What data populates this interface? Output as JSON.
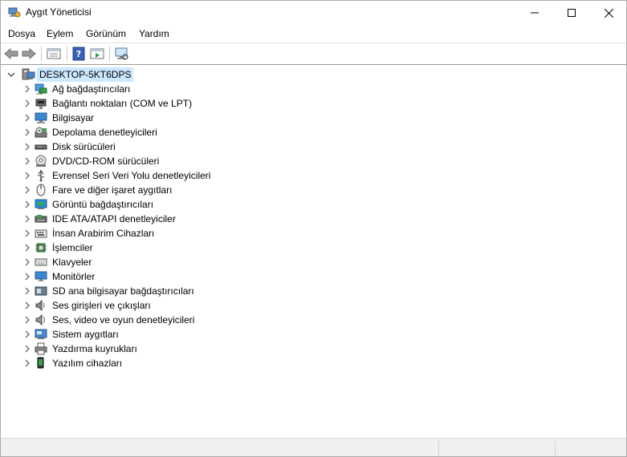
{
  "window": {
    "title": "Aygıt Yöneticisi"
  },
  "menu": {
    "items": [
      "Dosya",
      "Eylem",
      "Görünüm",
      "Yardım"
    ]
  },
  "toolbar": {
    "buttons": [
      "back-arrow-icon",
      "forward-arrow-icon",
      "properties-icon",
      "help-icon",
      "update-driver-icon",
      "scan-hardware-icon"
    ]
  },
  "tree": {
    "root": "DESKTOP-5KT6DPS",
    "items": [
      {
        "label": "Ağ bağdaştırıcıları",
        "icon": "network-adapter-icon"
      },
      {
        "label": "Bağlantı noktaları (COM ve LPT)",
        "icon": "port-icon"
      },
      {
        "label": "Bilgisayar",
        "icon": "computer-icon"
      },
      {
        "label": "Depolama denetleyicileri",
        "icon": "storage-controller-icon"
      },
      {
        "label": "Disk sürücüleri",
        "icon": "disk-drive-icon"
      },
      {
        "label": "DVD/CD-ROM sürücüleri",
        "icon": "dvd-drive-icon"
      },
      {
        "label": "Evrensel Seri Veri Yolu denetleyicileri",
        "icon": "usb-icon"
      },
      {
        "label": "Fare ve diğer işaret aygıtları",
        "icon": "mouse-icon"
      },
      {
        "label": "Görüntü bağdaştırıcıları",
        "icon": "display-adapter-icon"
      },
      {
        "label": "IDE ATA/ATAPI denetleyiciler",
        "icon": "ide-controller-icon"
      },
      {
        "label": "İnsan Arabirim Cihazları",
        "icon": "hid-icon"
      },
      {
        "label": "İşlemciler",
        "icon": "processor-icon"
      },
      {
        "label": "Klavyeler",
        "icon": "keyboard-icon"
      },
      {
        "label": "Monitörler",
        "icon": "monitor-icon"
      },
      {
        "label": "SD ana bilgisayar bağdaştırıcıları",
        "icon": "sd-host-icon"
      },
      {
        "label": "Ses girişleri ve çıkışları",
        "icon": "speaker-icon"
      },
      {
        "label": "Ses, video ve oyun denetleyicileri",
        "icon": "sound-controller-icon"
      },
      {
        "label": "Sistem aygıtları",
        "icon": "system-device-icon"
      },
      {
        "label": "Yazdırma kuyrukları",
        "icon": "printer-icon"
      },
      {
        "label": "Yazılım cihazları",
        "icon": "software-device-icon"
      }
    ]
  }
}
